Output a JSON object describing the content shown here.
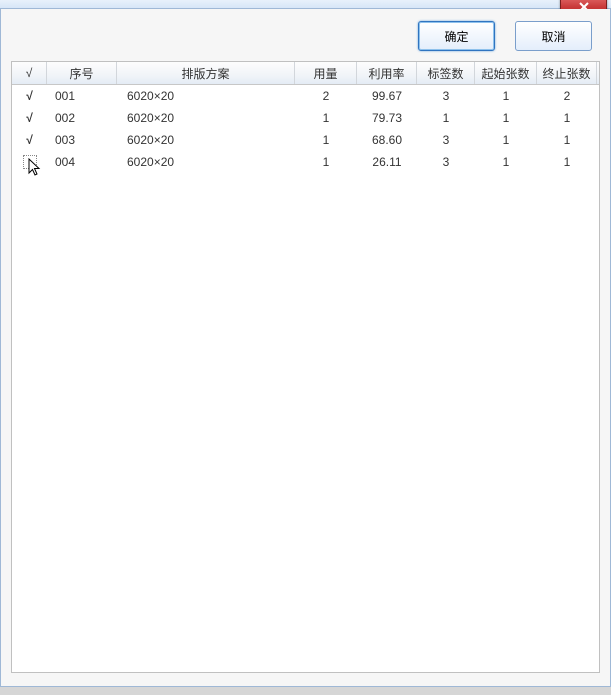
{
  "buttons": {
    "ok": "确定",
    "cancel": "取消"
  },
  "headers": {
    "check": "√",
    "seq": "序号",
    "plan": "排版方案",
    "qty": "用量",
    "util": "利用率",
    "tags": "标签数",
    "start": "起始张数",
    "end": "终止张数"
  },
  "rows": [
    {
      "checked": true,
      "seq": "001",
      "plan": "6020×20",
      "qty": "2",
      "util": "99.67",
      "tags": "3",
      "start": "1",
      "end": "2"
    },
    {
      "checked": true,
      "seq": "002",
      "plan": "6020×20",
      "qty": "1",
      "util": "79.73",
      "tags": "1",
      "start": "1",
      "end": "1"
    },
    {
      "checked": true,
      "seq": "003",
      "plan": "6020×20",
      "qty": "1",
      "util": "68.60",
      "tags": "3",
      "start": "1",
      "end": "1"
    },
    {
      "checked": false,
      "seq": "004",
      "plan": "6020×20",
      "qty": "1",
      "util": "26.11",
      "tags": "3",
      "start": "1",
      "end": "1"
    }
  ]
}
